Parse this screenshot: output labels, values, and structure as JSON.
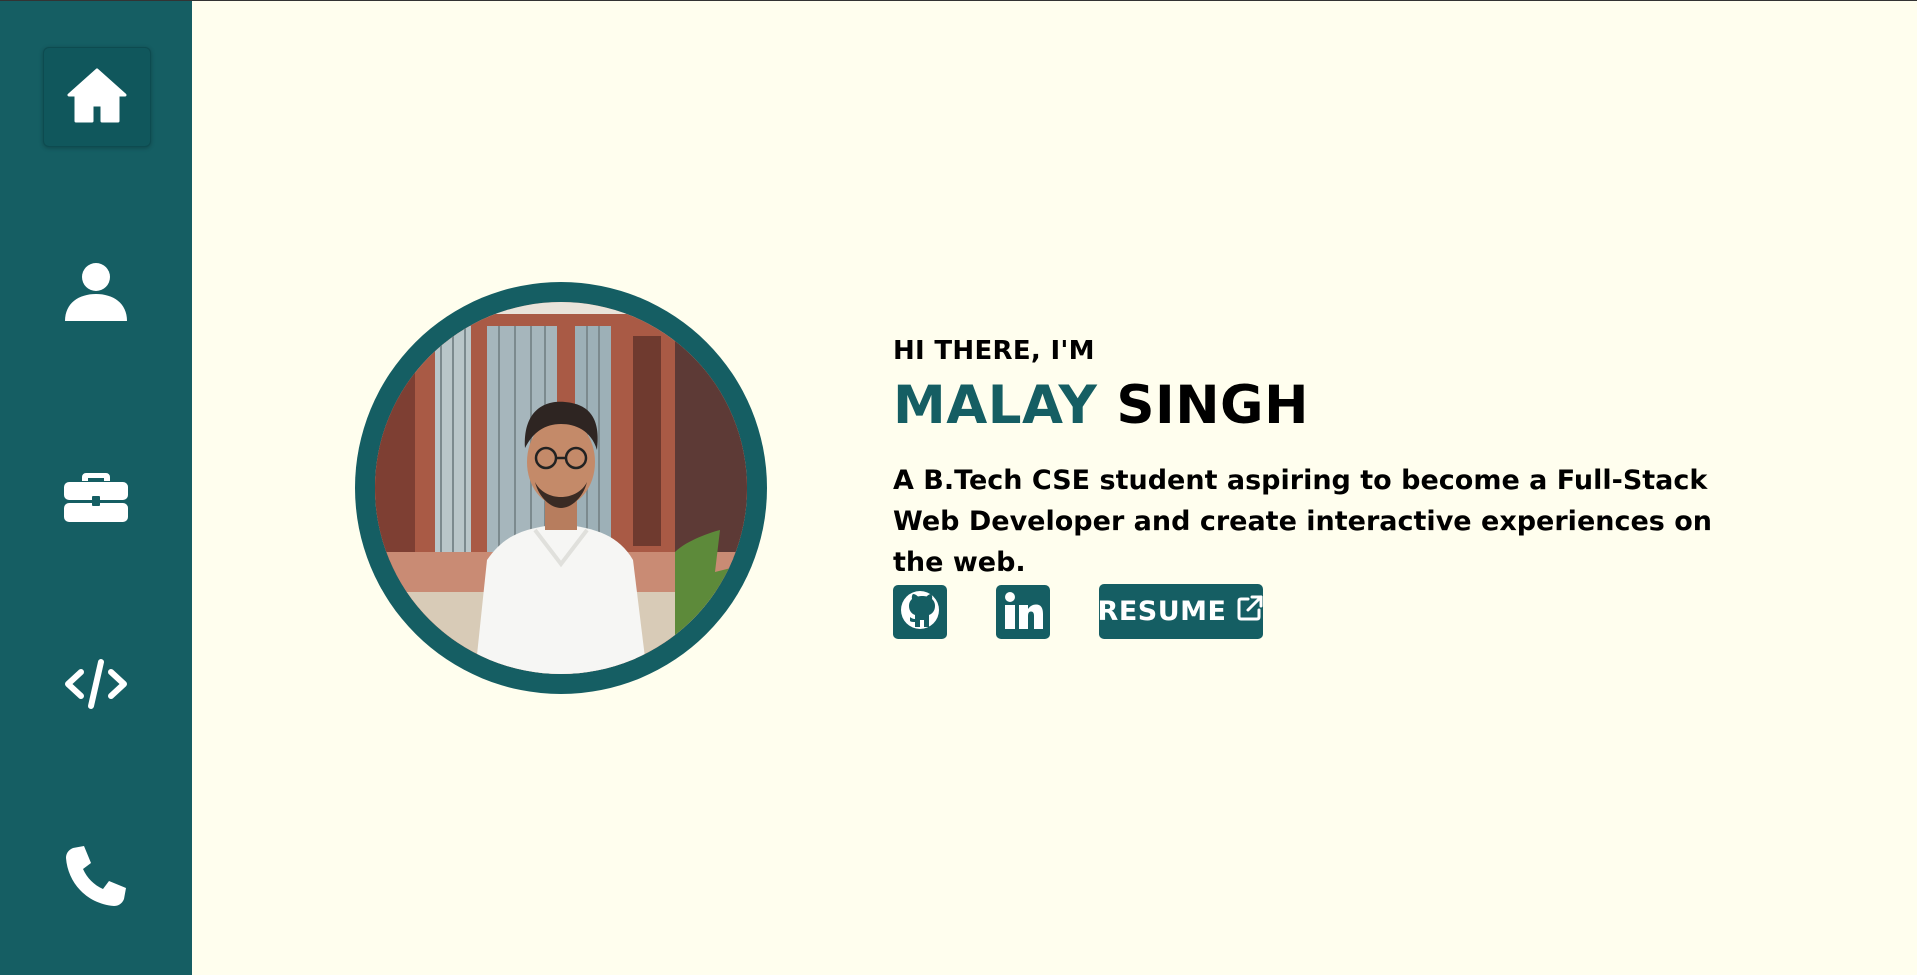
{
  "sidebar": {
    "items": [
      {
        "icon": "home-icon",
        "active": true
      },
      {
        "icon": "user-icon",
        "active": false
      },
      {
        "icon": "briefcase-icon",
        "active": false
      },
      {
        "icon": "code-icon",
        "active": false
      },
      {
        "icon": "phone-icon",
        "active": false
      }
    ]
  },
  "hero": {
    "greeting": "HI THERE, I'M",
    "first_name": "MALAY",
    "last_name": "SINGH",
    "description": "A B.Tech CSE student aspiring to become a Full-Stack Web Developer and create interactive experiences on the web.",
    "resume_label": "RESUME"
  },
  "links": [
    {
      "icon": "github-icon"
    },
    {
      "icon": "linkedin-icon"
    },
    {
      "icon": "external-link-icon"
    }
  ],
  "colors": {
    "accent": "#155e63",
    "background": "#fffeee",
    "text": "#000000"
  }
}
